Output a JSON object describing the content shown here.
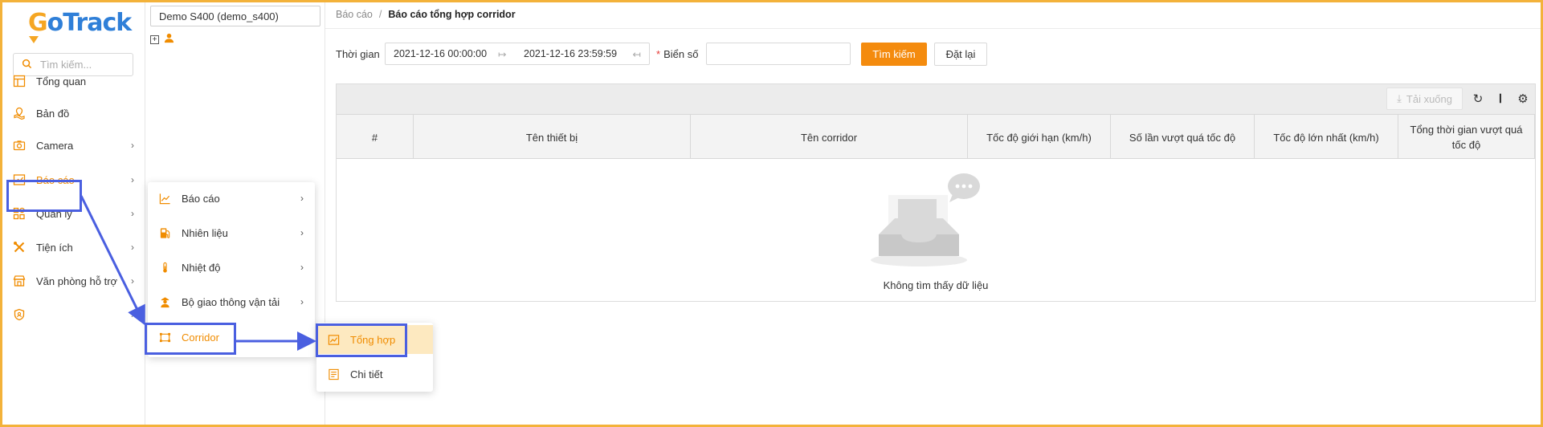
{
  "brand": {
    "logo_text_g": "G",
    "logo_text_rest": "oTrack"
  },
  "sidebar": {
    "search_placeholder": "Tìm kiếm...",
    "items": [
      {
        "label": "Tổng quan",
        "icon": "dashboard-icon"
      },
      {
        "label": "Bản đồ",
        "icon": "map-icon"
      },
      {
        "label": "Camera",
        "icon": "camera-icon",
        "has_children": true
      },
      {
        "label": "Báo cáo",
        "icon": "chart-icon",
        "has_children": true,
        "active": true
      },
      {
        "label": "Quản lý",
        "icon": "grid-icon",
        "has_children": true
      },
      {
        "label": "Tiện ích",
        "icon": "tools-icon",
        "has_children": true
      },
      {
        "label": "Văn phòng hỗ trợ",
        "icon": "store-icon",
        "has_children": true
      },
      {
        "label": "",
        "icon": "shield-icon",
        "has_children": true
      }
    ]
  },
  "tree": {
    "device": "Demo S400 (demo_s400)"
  },
  "report_menu": {
    "items": [
      {
        "label": "Báo cáo",
        "icon": "chart-line-icon"
      },
      {
        "label": "Nhiên liệu",
        "icon": "fuel-icon"
      },
      {
        "label": "Nhiệt độ",
        "icon": "thermometer-icon"
      },
      {
        "label": "Bộ giao thông vận tải",
        "icon": "officer-icon"
      },
      {
        "label": "Corridor",
        "icon": "corridor-icon"
      }
    ]
  },
  "corridor_menu": {
    "items": [
      {
        "label": "Tổng hợp",
        "icon": "summary-chart-icon"
      },
      {
        "label": "Chi tiết",
        "icon": "detail-list-icon"
      }
    ]
  },
  "breadcrumb": {
    "parent": "Báo cáo",
    "separator": "/",
    "current": "Báo cáo tổng hợp corridor"
  },
  "filters": {
    "time_label": "Thời gian",
    "start": "2021-12-16 00:00:00",
    "end": "2021-12-16 23:59:59",
    "plate_required_mark": "*",
    "plate_label": "Biển số",
    "plate_value": "",
    "search_button": "Tìm kiếm",
    "reset_button": "Đặt lại"
  },
  "table": {
    "download_label": "Tải xuống",
    "columns": [
      "#",
      "Tên thiết bị",
      "Tên corridor",
      "Tốc độ giới hạn (km/h)",
      "Số lần vượt quá tốc độ",
      "Tốc độ lớn nhất (km/h)",
      "Tổng thời gian vượt quá tốc độ"
    ],
    "empty_text": "Không tìm thấy dữ liệu",
    "rows": []
  },
  "colors": {
    "accent": "#f48b0e",
    "highlight": "#4a5fe0",
    "frame": "#f3b23a"
  }
}
